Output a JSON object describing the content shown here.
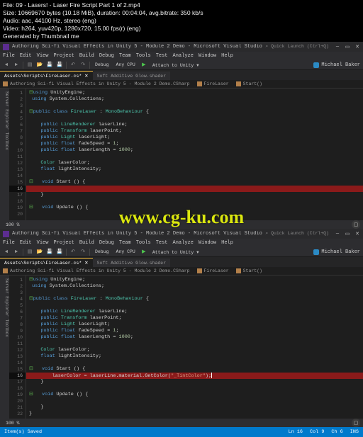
{
  "meta": {
    "file": "File: 09 - Lasers! - Laser Fire Script Part 1 of 2.mp4",
    "size": "Size: 10669670 bytes (10.18 MiB), duration: 00:04:04, avg.bitrate: 350 kb/s",
    "audio": "Audio: aac, 44100 Hz, stereo (eng)",
    "video": "Video: h264, yuv420p, 1280x720, 15.00 fps(r) (eng)",
    "gen": "Generated by Thumbnail me"
  },
  "watermark": "www.cg-ku.com",
  "vs": {
    "title": "Authoring Sci-fi Visual Effects in Unity 5 - Module 2 Demo - Microsoft Visual Studio",
    "quicklaunch": "⌕ Quick Launch (Ctrl+Q)",
    "menu": [
      "File",
      "Edit",
      "View",
      "Project",
      "Build",
      "Debug",
      "Team",
      "Tools",
      "Test",
      "Analyze",
      "Window",
      "Help"
    ],
    "toolbar": {
      "debug": "Debug",
      "anycpu": "Any CPU",
      "attach": "Attach to Unity ▾"
    },
    "user": "Michael Baker",
    "tabs": {
      "active": "Assets\\Scripts\\FireLaser.cs* ✕",
      "other": "Soft Additive Glow.shader"
    },
    "crumbs": {
      "ns": "Authoring Sci-fi Visual Effects in Unity 5 - Module 2 Demo.CSharp",
      "cls": "FireLaser",
      "m": "Start()"
    },
    "zoom": "100 %",
    "sidebar": "Server Explorer   Toolbox",
    "code_top": [
      {
        "n": 1,
        "t": "<span class='cm'>⊟</span><span class='kw'>using</span> <span class='id'>UnityEngine</span><span class='pn'>;</span>"
      },
      {
        "n": 2,
        "t": " <span class='kw'>using</span> <span class='id'>System.Collections</span><span class='pn'>;</span>"
      },
      {
        "n": 3,
        "t": ""
      },
      {
        "n": 4,
        "t": "<span class='cm'>⊟</span><span class='kw'>public class</span> <span class='cls'>FireLaser</span> <span class='pn'>:</span> <span class='cls'>MonoBehaviour</span> <span class='pn'>{</span>"
      },
      {
        "n": 5,
        "t": ""
      },
      {
        "n": 6,
        "t": "    <span class='kw'>public</span> <span class='cls'>LineRenderer</span> <span class='id'>laserLine</span><span class='pn'>;</span>"
      },
      {
        "n": 7,
        "t": "    <span class='kw'>public</span> <span class='cls'>Transform</span> <span class='id'>laserPoint</span><span class='pn'>;</span>"
      },
      {
        "n": 8,
        "t": "    <span class='kw'>public</span> <span class='cls'>Light</span> <span class='id'>laserLight</span><span class='pn'>;</span>"
      },
      {
        "n": 9,
        "t": "    <span class='kw'>public float</span> <span class='id'>fadeSpeed</span> <span class='pn'>=</span> <span class='num'>1</span><span class='pn'>;</span>"
      },
      {
        "n": 10,
        "t": "    <span class='kw'>public float</span> <span class='id'>laserLength</span> <span class='pn'>=</span> <span class='num'>1000</span><span class='pn'>;</span>"
      },
      {
        "n": 11,
        "t": ""
      },
      {
        "n": 12,
        "t": "    <span class='cls'>Color</span> <span class='id'>laserColor</span><span class='pn'>;</span>"
      },
      {
        "n": 13,
        "t": "    <span class='kw'>float</span> <span class='id'>lightIntensity</span><span class='pn'>;</span>"
      },
      {
        "n": 14,
        "t": ""
      },
      {
        "n": 15,
        "t": "<span class='cm'>⊟</span>   <span class='kw'>void</span> <span class='id'>Start</span> <span class='pn'>() {</span>"
      },
      {
        "n": 16,
        "t": "",
        "band": true
      },
      {
        "n": 17,
        "t": "    <span class='pn'>}</span>"
      },
      {
        "n": 18,
        "t": ""
      },
      {
        "n": 19,
        "t": "<span class='cm'>⊟</span>   <span class='kw'>void</span> <span class='id'>Update</span> <span class='pn'>() {</span>"
      },
      {
        "n": 20,
        "t": ""
      }
    ],
    "code_bottom": [
      {
        "n": 1,
        "t": "<span class='cm'>⊟</span><span class='kw'>using</span> <span class='id'>UnityEngine</span><span class='pn'>;</span>"
      },
      {
        "n": 2,
        "t": " <span class='kw'>using</span> <span class='id'>System.Collections</span><span class='pn'>;</span>"
      },
      {
        "n": 3,
        "t": ""
      },
      {
        "n": 4,
        "t": "<span class='cm'>⊟</span><span class='kw'>public class</span> <span class='cls'>FireLaser</span> <span class='pn'>:</span> <span class='cls'>MonoBehaviour</span> <span class='pn'>{</span>"
      },
      {
        "n": 5,
        "t": ""
      },
      {
        "n": 6,
        "t": "    <span class='kw'>public</span> <span class='cls'>LineRenderer</span> <span class='id'>laserLine</span><span class='pn'>;</span>"
      },
      {
        "n": 7,
        "t": "    <span class='kw'>public</span> <span class='cls'>Transform</span> <span class='id'>laserPoint</span><span class='pn'>;</span>"
      },
      {
        "n": 8,
        "t": "    <span class='kw'>public</span> <span class='cls'>Light</span> <span class='id'>laserLight</span><span class='pn'>;</span>"
      },
      {
        "n": 9,
        "t": "    <span class='kw'>public float</span> <span class='id'>fadeSpeed</span> <span class='pn'>=</span> <span class='num'>1</span><span class='pn'>;</span>"
      },
      {
        "n": 10,
        "t": "    <span class='kw'>public float</span> <span class='id'>laserLength</span> <span class='pn'>=</span> <span class='num'>1000</span><span class='pn'>;</span>"
      },
      {
        "n": 11,
        "t": ""
      },
      {
        "n": 12,
        "t": "    <span class='cls'>Color</span> <span class='id'>laserColor</span><span class='pn'>;</span>"
      },
      {
        "n": 13,
        "t": "    <span class='kw'>float</span> <span class='id'>lightIntensity</span><span class='pn'>;</span>"
      },
      {
        "n": 14,
        "t": ""
      },
      {
        "n": 15,
        "t": "<span class='cm'>⊟</span>   <span class='kw'>void</span> <span class='id'>Start</span> <span class='pn'>() {</span>"
      },
      {
        "n": 16,
        "t": "        <span class='id'>laserColor</span> <span class='pn'>=</span> <span class='id'>laserLine.material.GetColor(</span><span class='str'>\"_TintColor\"</span><span class='pn'>);</span><span class='caret'></span>",
        "band": true
      },
      {
        "n": 17,
        "t": "    <span class='pn'>}</span>"
      },
      {
        "n": 18,
        "t": ""
      },
      {
        "n": 19,
        "t": "<span class='cm'>⊟</span>   <span class='kw'>void</span> <span class='id'>Update</span> <span class='pn'>() {</span>"
      },
      {
        "n": 20,
        "t": ""
      },
      {
        "n": 21,
        "t": "    <span class='pn'>}</span>"
      },
      {
        "n": 22,
        "t": "<span class='pn'>}</span>"
      }
    ],
    "status": {
      "left": "Item(s) Saved",
      "ln": "Ln 16",
      "col": "Col 9",
      "ch": "Ch 6",
      "ins": "INS"
    }
  }
}
